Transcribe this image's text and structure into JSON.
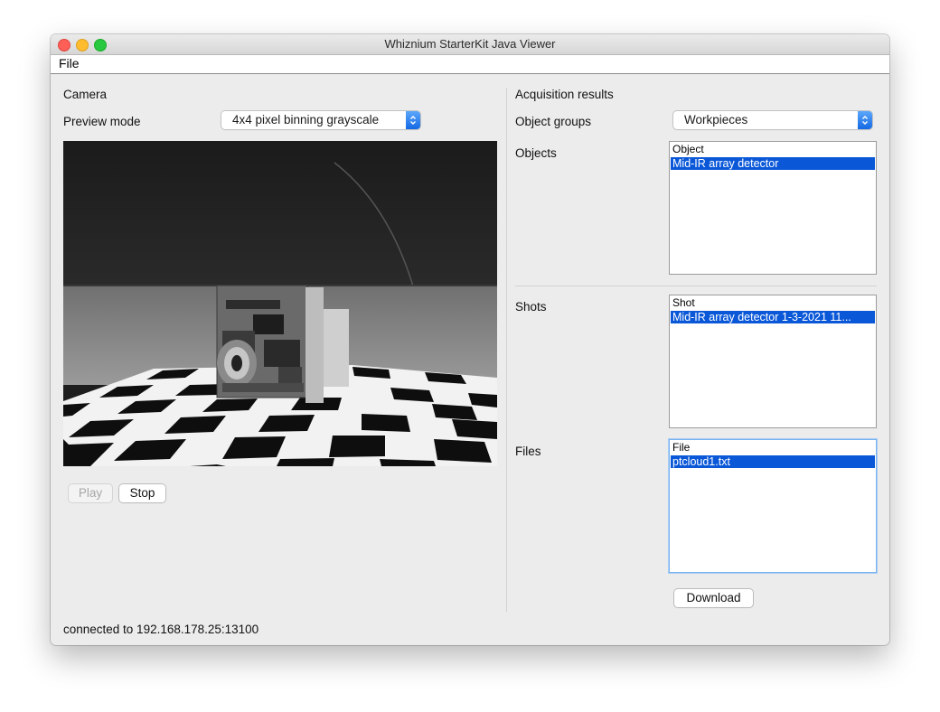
{
  "window": {
    "title": "Whiznium StarterKit Java Viewer"
  },
  "menu": {
    "file": "File"
  },
  "camera": {
    "heading": "Camera",
    "preview_label": "Preview mode",
    "preview_value": "4x4 pixel binning grayscale",
    "play": "Play",
    "stop": "Stop"
  },
  "results": {
    "heading": "Acquisition results",
    "groups_label": "Object groups",
    "groups_value": "Workpieces",
    "objects_label": "Objects",
    "objects_header": "Object",
    "objects_items": [
      "Mid-IR array detector"
    ],
    "shots_label": "Shots",
    "shots_header": "Shot",
    "shots_items": [
      "Mid-IR array detector 1-3-2021 11..."
    ],
    "files_label": "Files",
    "files_header": "File",
    "files_items": [
      "ptcloud1.txt"
    ],
    "download": "Download"
  },
  "status": {
    "text": "connected to 192.168.178.25:13100"
  },
  "colors": {
    "selection": "#0a58d8",
    "window_bg": "#ececec",
    "select_arrow": "#1469e4"
  }
}
